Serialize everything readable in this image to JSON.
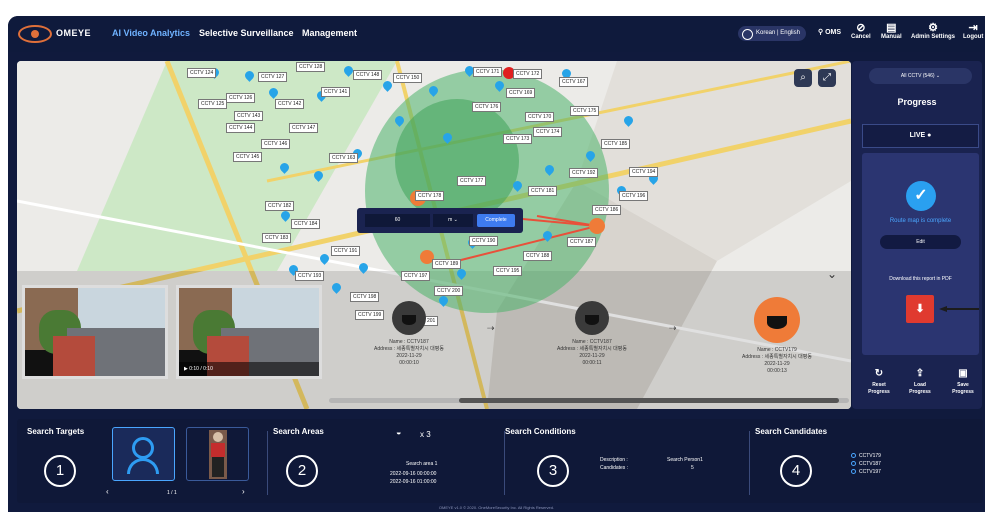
{
  "header": {
    "brand": "OMEYE",
    "nav": [
      "AI Video Analytics",
      "Selective Surveillance",
      "Management"
    ],
    "language": "Korean | English",
    "user": "OMS",
    "buttons": [
      "Cancel",
      "Manual",
      "Admin Settings",
      "Logout"
    ]
  },
  "map": {
    "cctv_labels": [
      "CCTV 124",
      "CCTV 127",
      "CCTV 128",
      "CCTV 148",
      "CCTV 150",
      "CCTV 125",
      "CCTV 126",
      "CCTV 141",
      "CCTV 142",
      "CCTV 143",
      "CCTV 144",
      "CCTV 147",
      "CCTV 146",
      "CCTV 145",
      "CCTV 163",
      "CCTV 171",
      "CCTV 172",
      "CCTV 167",
      "CCTV 169",
      "CCTV 175",
      "CCTV 170",
      "CCTV 173",
      "CCTV 174",
      "CCTV 176",
      "CCTV 177",
      "CCTV 178",
      "CCTV 181",
      "CCTV 182",
      "CCTV 183",
      "CCTV 184",
      "CCTV 185",
      "CCTV 186",
      "CCTV 187",
      "CCTV 188",
      "CCTV 189",
      "CCTV 190",
      "CCTV 191",
      "CCTV 192",
      "CCTV 193",
      "CCTV 194",
      "CCTV 195",
      "CCTV 196",
      "CCTV 197",
      "CCTV 198",
      "CCTV 199",
      "CCTV 200",
      "CCTV 201"
    ],
    "popup": {
      "value": "60",
      "unit": "m",
      "complete": "Complete"
    },
    "video_time": "0:10 / 0:10"
  },
  "path": [
    {
      "name": "Name : CCTV187",
      "address": "Address : 세종특별자치시 대평동",
      "date": "2022-11-29",
      "time": "00:00:10"
    },
    {
      "name": "Name : CCTV187",
      "address": "Address : 세종특별자치시 대평동",
      "date": "2022-11-29",
      "time": "00:00:11"
    },
    {
      "name": "Name : CCTV179",
      "address": "Address : 세종특별자치시 대평동",
      "date": "2022-11-29",
      "time": "00:00:13"
    }
  ],
  "side": {
    "camera_select": "All CCTV (546)",
    "title": "Progress",
    "live": "LIVE",
    "route_text": "Route map is complete",
    "edit": "Edit",
    "download": "Download this report in PDF",
    "buttons": [
      "Reset Progress",
      "Load Progress",
      "Save Progress"
    ]
  },
  "bottom": {
    "targets": {
      "title": "Search Targets",
      "num": "1",
      "pager": "1 / 1"
    },
    "areas": {
      "title": "Search Areas",
      "num": "2",
      "count": "x 3",
      "area_name": "Search area 1",
      "from": "2022-09-16 00:00:00",
      "to": "2022-09-16 01:00:00"
    },
    "conditions": {
      "title": "Search Conditions",
      "num": "3",
      "desc_label": "Description :",
      "desc_value": "Search Person1",
      "cand_label": "Candidates :",
      "cand_value": "5"
    },
    "candidates": {
      "title": "Search Candidates",
      "num": "4",
      "items": [
        "CCTV179",
        "CCTV187",
        "CCTV197"
      ]
    }
  },
  "footer": "OMEYE v1.0 © 2020. OneMoreSecurity Inc. All Rights Reserved.",
  "colors": {
    "accent": "#2e9cf2",
    "panel": "#1a2350",
    "alert": "#ef7b38"
  }
}
